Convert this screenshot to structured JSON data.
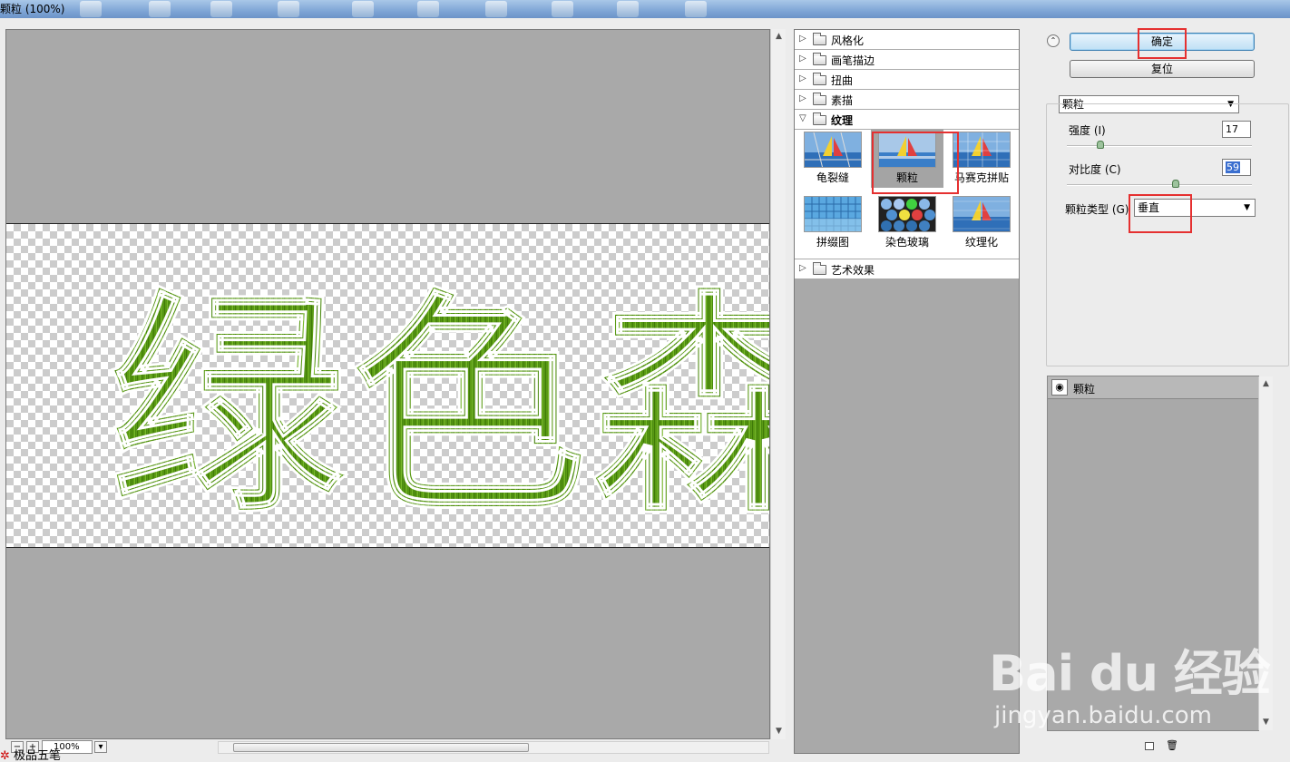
{
  "window": {
    "title": "颗粒 (100%)"
  },
  "preview": {
    "zoom": "100%",
    "text_art": "绿色森",
    "text_color": "#5a9a14",
    "bottom_strip_text": "极品五笔"
  },
  "filter_gallery": {
    "categories": [
      {
        "label": "风格化",
        "expanded": false
      },
      {
        "label": "画笔描边",
        "expanded": false
      },
      {
        "label": "扭曲",
        "expanded": false
      },
      {
        "label": "素描",
        "expanded": false
      },
      {
        "label": "纹理",
        "expanded": true
      },
      {
        "label": "艺术效果",
        "expanded": false
      }
    ],
    "texture_filters": [
      {
        "label": "龟裂缝",
        "selected": false
      },
      {
        "label": "颗粒",
        "selected": true
      },
      {
        "label": "马赛克拼贴",
        "selected": false
      },
      {
        "label": "拼缀图",
        "selected": false
      },
      {
        "label": "染色玻璃",
        "selected": false
      },
      {
        "label": "纹理化",
        "selected": false
      }
    ]
  },
  "controls": {
    "ok_label": "确定",
    "reset_label": "复位",
    "filter_select": "颗粒",
    "intensity_label": "强度 (I)",
    "intensity_value": "17",
    "contrast_label": "对比度 (C)",
    "contrast_value": "59",
    "grain_type_label": "颗粒类型 (G)",
    "grain_type_value": "垂直"
  },
  "layers": {
    "items": [
      {
        "label": "颗粒",
        "visible": true
      }
    ]
  },
  "watermark": {
    "logo": "Bai du 经验",
    "url": "jingyan.baidu.com"
  },
  "colors": {
    "highlight": "#e53030",
    "ok_button": "#bfe0f5"
  }
}
